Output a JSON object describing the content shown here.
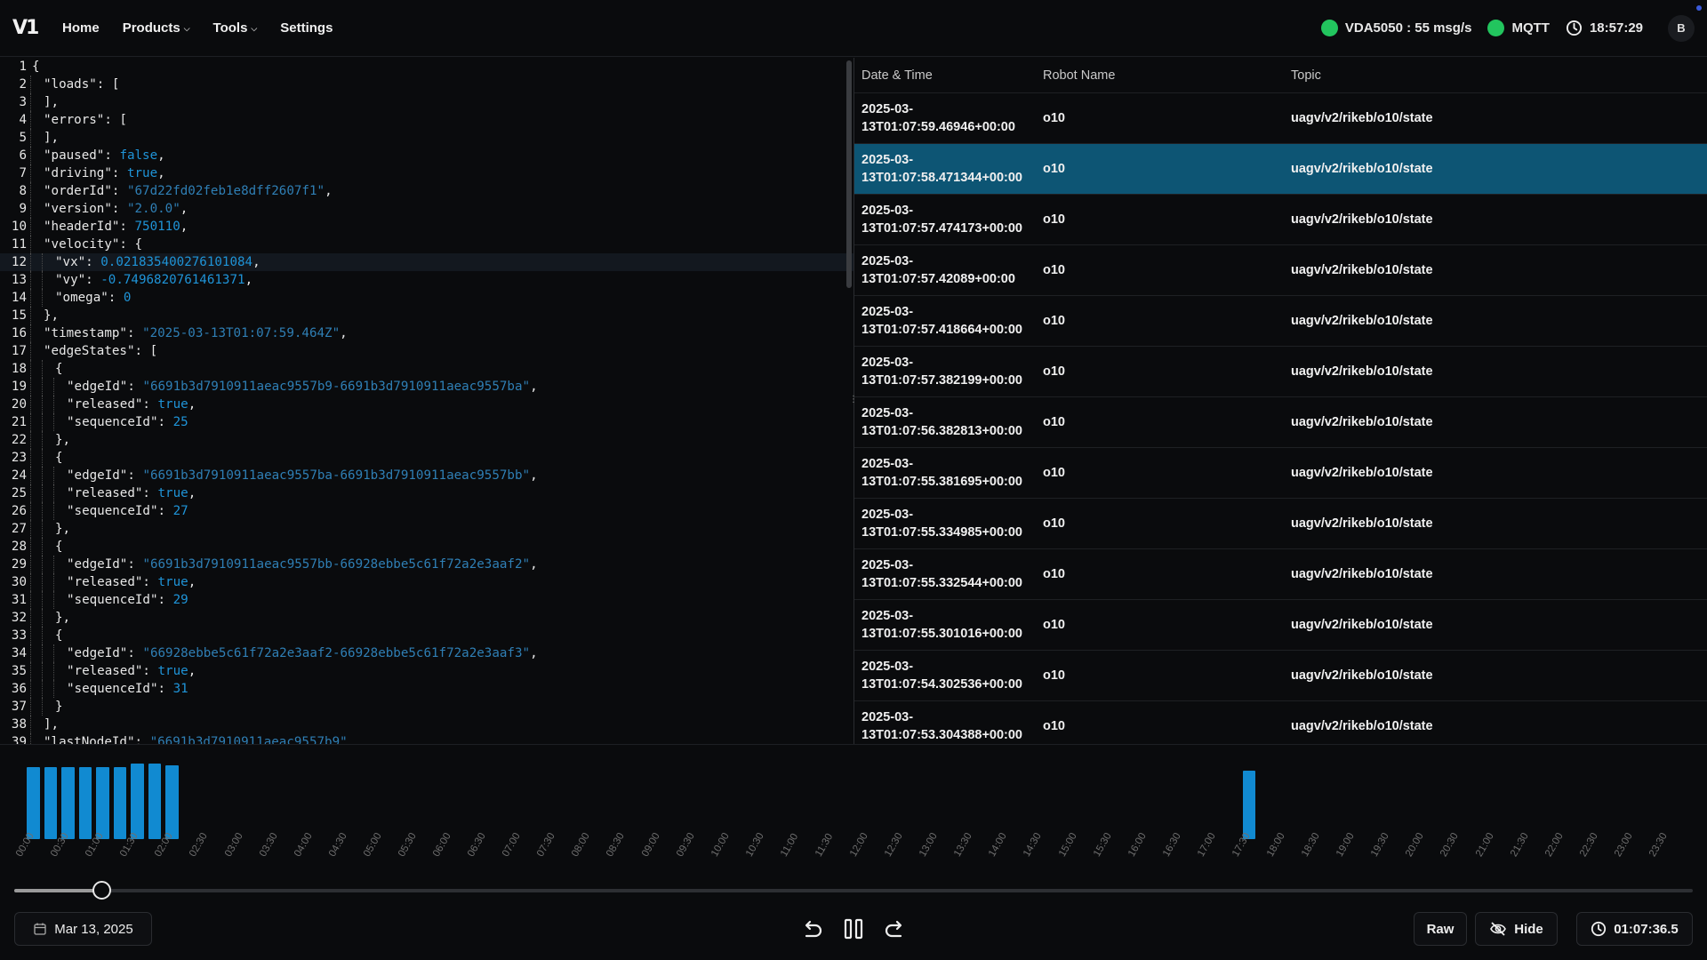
{
  "header": {
    "logo": "V1",
    "nav": [
      {
        "label": "Home"
      },
      {
        "label": "Products",
        "dropdown": true
      },
      {
        "label": "Tools",
        "dropdown": true
      },
      {
        "label": "Settings"
      }
    ],
    "vda_status": "VDA5050 : 55 msg/s",
    "mqtt_status": "MQTT",
    "time": "18:57:29",
    "user_initial": "B",
    "status_color": "#22c55e"
  },
  "code": {
    "lines": [
      [
        {
          "t": "p",
          "v": "{"
        }
      ],
      [
        {
          "t": "k",
          "v": "\"loads\""
        },
        {
          "t": "p",
          "v": ": ["
        }
      ],
      [
        {
          "t": "p",
          "v": "],"
        }
      ],
      [
        {
          "t": "k",
          "v": "\"errors\""
        },
        {
          "t": "p",
          "v": ": ["
        }
      ],
      [
        {
          "t": "p",
          "v": "],"
        }
      ],
      [
        {
          "t": "k",
          "v": "\"paused\""
        },
        {
          "t": "p",
          "v": ": "
        },
        {
          "t": "n",
          "v": "false"
        },
        {
          "t": "p",
          "v": ","
        }
      ],
      [
        {
          "t": "k",
          "v": "\"driving\""
        },
        {
          "t": "p",
          "v": ": "
        },
        {
          "t": "n",
          "v": "true"
        },
        {
          "t": "p",
          "v": ","
        }
      ],
      [
        {
          "t": "k",
          "v": "\"orderId\""
        },
        {
          "t": "p",
          "v": ": "
        },
        {
          "t": "s",
          "v": "\"67d22fd02feb1e8dff2607f1\""
        },
        {
          "t": "p",
          "v": ","
        }
      ],
      [
        {
          "t": "k",
          "v": "\"version\""
        },
        {
          "t": "p",
          "v": ": "
        },
        {
          "t": "s",
          "v": "\"2.0.0\""
        },
        {
          "t": "p",
          "v": ","
        }
      ],
      [
        {
          "t": "k",
          "v": "\"headerId\""
        },
        {
          "t": "p",
          "v": ": "
        },
        {
          "t": "n",
          "v": "750110"
        },
        {
          "t": "p",
          "v": ","
        }
      ],
      [
        {
          "t": "k",
          "v": "\"velocity\""
        },
        {
          "t": "p",
          "v": ": {"
        }
      ],
      [
        {
          "t": "k",
          "v": "\"vx\""
        },
        {
          "t": "p",
          "v": ": "
        },
        {
          "t": "n",
          "v": "0.021835400276101084"
        },
        {
          "t": "p",
          "v": ","
        }
      ],
      [
        {
          "t": "k",
          "v": "\"vy\""
        },
        {
          "t": "p",
          "v": ": "
        },
        {
          "t": "n",
          "v": "-0.7496820761461371"
        },
        {
          "t": "p",
          "v": ","
        }
      ],
      [
        {
          "t": "k",
          "v": "\"omega\""
        },
        {
          "t": "p",
          "v": ": "
        },
        {
          "t": "n",
          "v": "0"
        }
      ],
      [
        {
          "t": "p",
          "v": "},"
        }
      ],
      [
        {
          "t": "k",
          "v": "\"timestamp\""
        },
        {
          "t": "p",
          "v": ": "
        },
        {
          "t": "s",
          "v": "\"2025-03-13T01:07:59.464Z\""
        },
        {
          "t": "p",
          "v": ","
        }
      ],
      [
        {
          "t": "k",
          "v": "\"edgeStates\""
        },
        {
          "t": "p",
          "v": ": ["
        }
      ],
      [
        {
          "t": "p",
          "v": "{"
        }
      ],
      [
        {
          "t": "k",
          "v": "\"edgeId\""
        },
        {
          "t": "p",
          "v": ": "
        },
        {
          "t": "s",
          "v": "\"6691b3d7910911aeac9557b9-6691b3d7910911aeac9557ba\""
        },
        {
          "t": "p",
          "v": ","
        }
      ],
      [
        {
          "t": "k",
          "v": "\"released\""
        },
        {
          "t": "p",
          "v": ": "
        },
        {
          "t": "n",
          "v": "true"
        },
        {
          "t": "p",
          "v": ","
        }
      ],
      [
        {
          "t": "k",
          "v": "\"sequenceId\""
        },
        {
          "t": "p",
          "v": ": "
        },
        {
          "t": "n",
          "v": "25"
        }
      ],
      [
        {
          "t": "p",
          "v": "},"
        }
      ],
      [
        {
          "t": "p",
          "v": "{"
        }
      ],
      [
        {
          "t": "k",
          "v": "\"edgeId\""
        },
        {
          "t": "p",
          "v": ": "
        },
        {
          "t": "s",
          "v": "\"6691b3d7910911aeac9557ba-6691b3d7910911aeac9557bb\""
        },
        {
          "t": "p",
          "v": ","
        }
      ],
      [
        {
          "t": "k",
          "v": "\"released\""
        },
        {
          "t": "p",
          "v": ": "
        },
        {
          "t": "n",
          "v": "true"
        },
        {
          "t": "p",
          "v": ","
        }
      ],
      [
        {
          "t": "k",
          "v": "\"sequenceId\""
        },
        {
          "t": "p",
          "v": ": "
        },
        {
          "t": "n",
          "v": "27"
        }
      ],
      [
        {
          "t": "p",
          "v": "},"
        }
      ],
      [
        {
          "t": "p",
          "v": "{"
        }
      ],
      [
        {
          "t": "k",
          "v": "\"edgeId\""
        },
        {
          "t": "p",
          "v": ": "
        },
        {
          "t": "s",
          "v": "\"6691b3d7910911aeac9557bb-66928ebbe5c61f72a2e3aaf2\""
        },
        {
          "t": "p",
          "v": ","
        }
      ],
      [
        {
          "t": "k",
          "v": "\"released\""
        },
        {
          "t": "p",
          "v": ": "
        },
        {
          "t": "n",
          "v": "true"
        },
        {
          "t": "p",
          "v": ","
        }
      ],
      [
        {
          "t": "k",
          "v": "\"sequenceId\""
        },
        {
          "t": "p",
          "v": ": "
        },
        {
          "t": "n",
          "v": "29"
        }
      ],
      [
        {
          "t": "p",
          "v": "},"
        }
      ],
      [
        {
          "t": "p",
          "v": "{"
        }
      ],
      [
        {
          "t": "k",
          "v": "\"edgeId\""
        },
        {
          "t": "p",
          "v": ": "
        },
        {
          "t": "s",
          "v": "\"66928ebbe5c61f72a2e3aaf2-66928ebbe5c61f72a2e3aaf3\""
        },
        {
          "t": "p",
          "v": ","
        }
      ],
      [
        {
          "t": "k",
          "v": "\"released\""
        },
        {
          "t": "p",
          "v": ": "
        },
        {
          "t": "n",
          "v": "true"
        },
        {
          "t": "p",
          "v": ","
        }
      ],
      [
        {
          "t": "k",
          "v": "\"sequenceId\""
        },
        {
          "t": "p",
          "v": ": "
        },
        {
          "t": "n",
          "v": "31"
        }
      ],
      [
        {
          "t": "p",
          "v": "}"
        }
      ],
      [
        {
          "t": "p",
          "v": "],"
        }
      ],
      [
        {
          "t": "k",
          "v": "\"lastNodeId\""
        },
        {
          "t": "p",
          "v": ": "
        },
        {
          "t": "s",
          "v": "\"6691b3d7910911aeac9557b9\""
        }
      ]
    ],
    "indent": [
      0,
      1,
      1,
      1,
      1,
      1,
      1,
      1,
      1,
      1,
      1,
      2,
      2,
      2,
      1,
      1,
      1,
      2,
      3,
      3,
      3,
      2,
      2,
      3,
      3,
      3,
      2,
      2,
      3,
      3,
      3,
      2,
      2,
      3,
      3,
      3,
      2,
      1,
      1
    ],
    "active_line": 12
  },
  "table": {
    "columns": [
      "Date & Time",
      "Robot Name",
      "Topic"
    ],
    "selected_row": 1,
    "rows": [
      {
        "dt": "2025-03-\n13T01:07:59.46946+00:00",
        "robot": "o10",
        "topic": "uagv/v2/rikeb/o10/state"
      },
      {
        "dt": "2025-03-\n13T01:07:58.471344+00:00",
        "robot": "o10",
        "topic": "uagv/v2/rikeb/o10/state"
      },
      {
        "dt": "2025-03-\n13T01:07:57.474173+00:00",
        "robot": "o10",
        "topic": "uagv/v2/rikeb/o10/state"
      },
      {
        "dt": "2025-03-\n13T01:07:57.42089+00:00",
        "robot": "o10",
        "topic": "uagv/v2/rikeb/o10/state"
      },
      {
        "dt": "2025-03-\n13T01:07:57.418664+00:00",
        "robot": "o10",
        "topic": "uagv/v2/rikeb/o10/state"
      },
      {
        "dt": "2025-03-\n13T01:07:57.382199+00:00",
        "robot": "o10",
        "topic": "uagv/v2/rikeb/o10/state"
      },
      {
        "dt": "2025-03-\n13T01:07:56.382813+00:00",
        "robot": "o10",
        "topic": "uagv/v2/rikeb/o10/state"
      },
      {
        "dt": "2025-03-\n13T01:07:55.381695+00:00",
        "robot": "o10",
        "topic": "uagv/v2/rikeb/o10/state"
      },
      {
        "dt": "2025-03-\n13T01:07:55.334985+00:00",
        "robot": "o10",
        "topic": "uagv/v2/rikeb/o10/state"
      },
      {
        "dt": "2025-03-\n13T01:07:55.332544+00:00",
        "robot": "o10",
        "topic": "uagv/v2/rikeb/o10/state"
      },
      {
        "dt": "2025-03-\n13T01:07:55.301016+00:00",
        "robot": "o10",
        "topic": "uagv/v2/rikeb/o10/state"
      },
      {
        "dt": "2025-03-\n13T01:07:54.302536+00:00",
        "robot": "o10",
        "topic": "uagv/v2/rikeb/o10/state"
      },
      {
        "dt": "2025-03-\n13T01:07:53.304388+00:00",
        "robot": "o10",
        "topic": "uagv/v2/rikeb/o10/state"
      }
    ]
  },
  "timeline": {
    "ticks": [
      "00:00",
      "00:30",
      "01:00",
      "01:30",
      "02:00",
      "02:30",
      "03:00",
      "03:30",
      "04:00",
      "04:30",
      "05:00",
      "05:30",
      "06:00",
      "06:30",
      "07:00",
      "07:30",
      "08:00",
      "08:30",
      "09:00",
      "09:30",
      "10:00",
      "10:30",
      "11:00",
      "11:30",
      "12:00",
      "12:30",
      "13:00",
      "13:30",
      "14:00",
      "14:30",
      "15:00",
      "15:30",
      "16:00",
      "16:30",
      "17:00",
      "17:30",
      "18:00",
      "18:30",
      "19:00",
      "19:30",
      "20:00",
      "20:30",
      "21:00",
      "21:30",
      "22:00",
      "22:30",
      "23:00",
      "23:30"
    ],
    "activity": [
      {
        "slot": 0,
        "level": 0.9
      },
      {
        "slot": 1,
        "level": 0.9
      },
      {
        "slot": 2,
        "level": 0.9
      },
      {
        "slot": 3,
        "level": 0.9
      },
      {
        "slot": 4,
        "level": 0.9
      },
      {
        "slot": 5,
        "level": 0.9
      },
      {
        "slot": 6,
        "level": 0.95
      },
      {
        "slot": 7,
        "level": 0.94
      },
      {
        "slot": 8,
        "level": 0.92
      },
      {
        "slot": 70,
        "level": 0.86
      }
    ],
    "slots_per_day": 96,
    "bar_color": "#118ad1",
    "playback_position": 0.052
  },
  "footer": {
    "date": "Mar 13, 2025",
    "raw_label": "Raw",
    "hide_label": "Hide",
    "time_label": "01:07:36.5"
  }
}
